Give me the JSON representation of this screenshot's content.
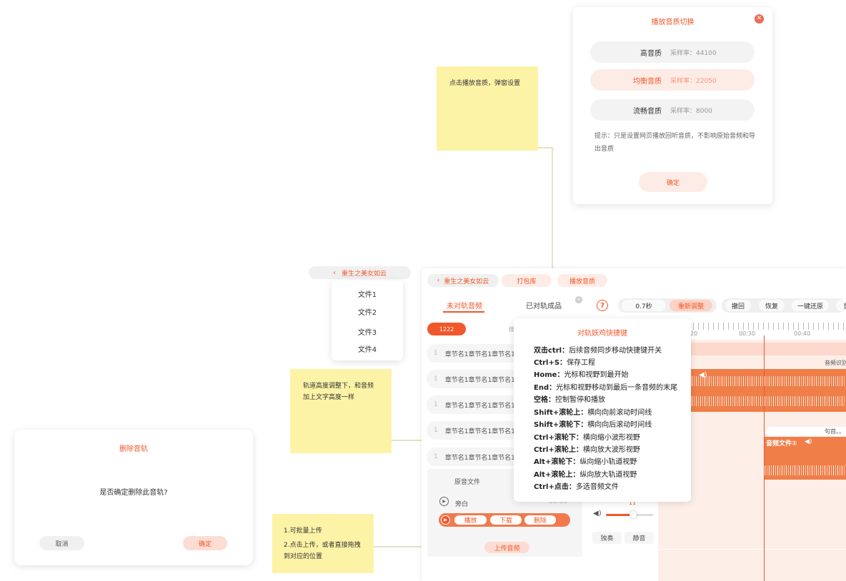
{
  "quality_dialog": {
    "title": "播放音质切换",
    "options": [
      {
        "name": "高音质",
        "rate": "采样率：44100"
      },
      {
        "name": "均衡音质",
        "rate": "采样率：22050"
      },
      {
        "name": "流畅音质",
        "rate": "采样率：8000"
      }
    ],
    "selected_index": 1,
    "tip": "提示：只是设置网页播放回听音质，不影响原始音频和导出音质",
    "confirm_label": "确定"
  },
  "notes": {
    "quality_note": "点击播放音质，弹窗设置",
    "track_height_note": "轨道高度调整下，和音频加上文字高度一样",
    "upload_note_1": "1.可批量上传",
    "upload_note_2": "2.点击上传，或者直接拖拽到对应的位置"
  },
  "book_menu": {
    "title": "重生之美女如云",
    "items": [
      "文件1",
      "文件2",
      "文件3",
      "文件4"
    ]
  },
  "delete_dialog": {
    "title": "删除音轨",
    "message": "是否确定删除此音轨?",
    "cancel_label": "取消",
    "confirm_label": "确定"
  },
  "editor": {
    "back_label": "重生之美女如云",
    "pack_label": "打包库",
    "play_quality_label": "播放音质",
    "tabs": [
      "未对轨音频",
      "已对轨成品"
    ],
    "active_tab": 0,
    "tag_label": "1222",
    "chapter_rows": [
      {
        "num": "1",
        "text": "章节名1章节名1章节名1"
      },
      {
        "num": "1",
        "text": "章节名1章节名1章节名1"
      },
      {
        "num": "1",
        "text": "章节名1章节名1章节名1"
      },
      {
        "num": "1",
        "text": "章节名1章节名1章节名1"
      },
      {
        "num": "1",
        "text": "章节名1章节名1章节名1"
      }
    ],
    "original_audio_label": "原音文件",
    "narration_label": "旁白",
    "narration_time": "00:00",
    "action_play": "播放",
    "action_download": "下载",
    "action_delete": "删除",
    "upload_label": "上传音频",
    "toolbar": {
      "time_value": "0.7秒",
      "readjust": "重新调整",
      "undo": "撤回",
      "redo": "恢复",
      "restore": "一键还原",
      "cut": "剪"
    },
    "ruler_ticks": [
      "20",
      "00:30",
      "00:40"
    ],
    "track_label_right": "音频识别",
    "sentence_label": "句首。。",
    "audio_file_label": "音频文件①",
    "solo_label": "独奏",
    "mute_label": "静音",
    "volume_level": 0.6
  },
  "shortcuts": {
    "title": "对轨妖鸡快捷键",
    "items": [
      {
        "key": "双击ctrl：",
        "desc": "后续音频同步移动快捷键开关"
      },
      {
        "key": "Ctrl+S：",
        "desc": "保存工程"
      },
      {
        "key": "Home：",
        "desc": "光标和视野到最开始"
      },
      {
        "key": "End：",
        "desc": "光标和视野移动到最后一条音频的末尾"
      },
      {
        "key": "空格：",
        "desc": "控制暂停和播放"
      },
      {
        "key": "Shift+滚轮上：",
        "desc": "横向向前滚动时间线"
      },
      {
        "key": "Shift+滚轮下：",
        "desc": "横向向后滚动时间线"
      },
      {
        "key": "Ctrl+滚轮下：",
        "desc": "横向缩小波形视野"
      },
      {
        "key": "Ctrl+滚轮上：",
        "desc": "横向放大波形视野"
      },
      {
        "key": "Alt+滚轮下：",
        "desc": "纵向缩小轨道视野"
      },
      {
        "key": "Alt+滚轮上：",
        "desc": "纵向放大轨道视野"
      },
      {
        "key": "Ctrl+点击：",
        "desc": "多选音频文件"
      }
    ]
  },
  "colors": {
    "accent": "#f0582a",
    "sticky": "#fdf3a6",
    "track": "#ef7e49",
    "timeline_bg": "#fdeee8"
  }
}
